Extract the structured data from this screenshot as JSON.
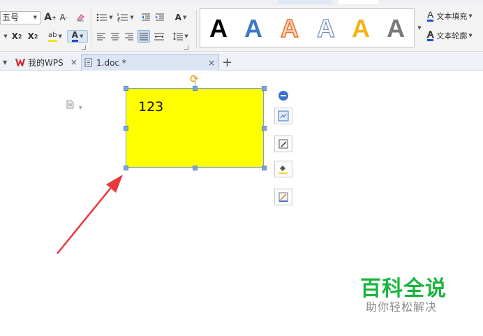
{
  "ribbon": {
    "font_size_value": "五号",
    "grow_font": "A",
    "shrink_font": "A",
    "superscript": "X",
    "subscript": "X",
    "highlight": "ab",
    "font_color": "A",
    "text_direction": "A",
    "art_styles": [
      "A",
      "A",
      "A",
      "A",
      "A",
      "A"
    ],
    "fill_label": "文本填充",
    "outline_label": "文本轮廓"
  },
  "doc_tabs": {
    "wps_label": "我的WPS",
    "doc_label": "1.doc *",
    "close_glyph": "×",
    "new_tab_glyph": "+"
  },
  "canvas": {
    "textbox_text": "123"
  },
  "watermark": {
    "title": "百科全说",
    "subtitle": "助你轻松解决"
  },
  "colors": {
    "textbox_fill": "#ffff00",
    "arrow": "#e8393c",
    "watermark": "#19b53f",
    "handle": "#7fa7d6"
  }
}
